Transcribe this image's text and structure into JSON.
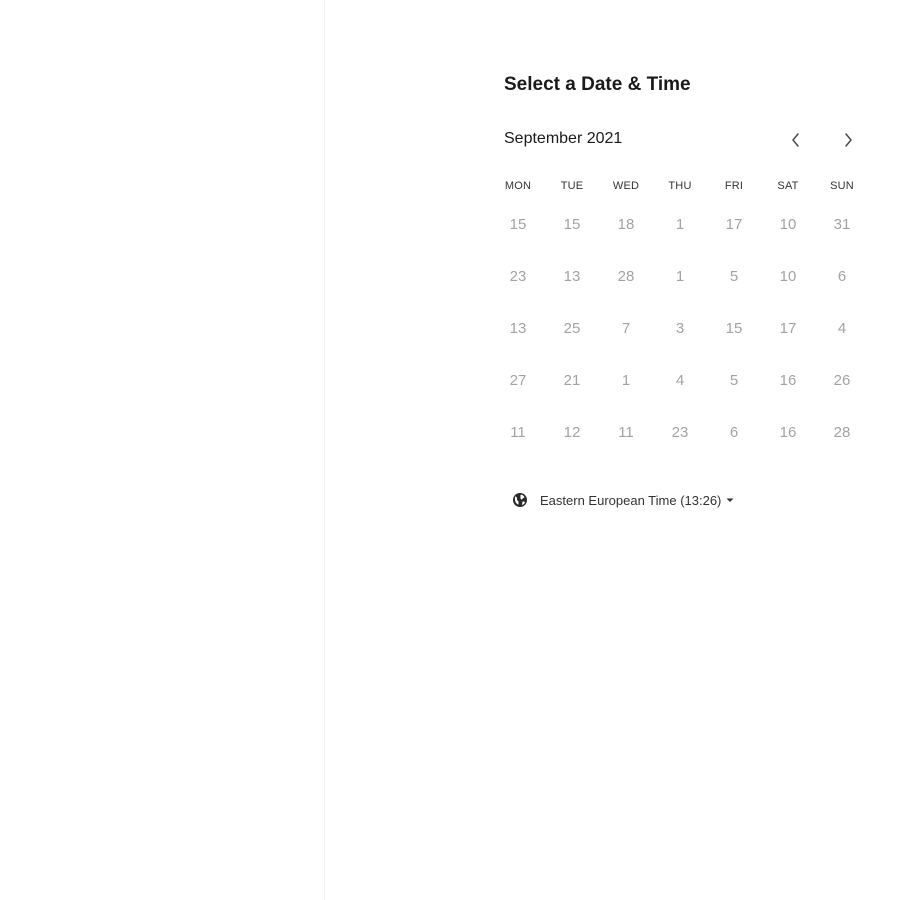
{
  "heading": "Select a Date & Time",
  "calendar": {
    "month_label": "September 2021",
    "weekdays": [
      "MON",
      "TUE",
      "WED",
      "THU",
      "FRI",
      "SAT",
      "SUN"
    ],
    "weeks": [
      [
        "15",
        "15",
        "18",
        "1",
        "17",
        "10",
        "31"
      ],
      [
        "23",
        "13",
        "28",
        "1",
        "5",
        "10",
        "6"
      ],
      [
        "13",
        "25",
        "7",
        "3",
        "15",
        "17",
        "4"
      ],
      [
        "27",
        "21",
        "1",
        "4",
        "5",
        "16",
        "26"
      ],
      [
        "11",
        "12",
        "11",
        "23",
        "6",
        "16",
        "28"
      ]
    ]
  },
  "timezone": {
    "label": "Eastern European Time (13:26)"
  },
  "icons": {
    "prev": "chevron-left-icon",
    "next": "chevron-right-icon",
    "globe": "globe-icon",
    "caret": "caret-down-icon"
  },
  "colors": {
    "text": "#1a1a1a",
    "muted_day": "#a3a3a3"
  }
}
